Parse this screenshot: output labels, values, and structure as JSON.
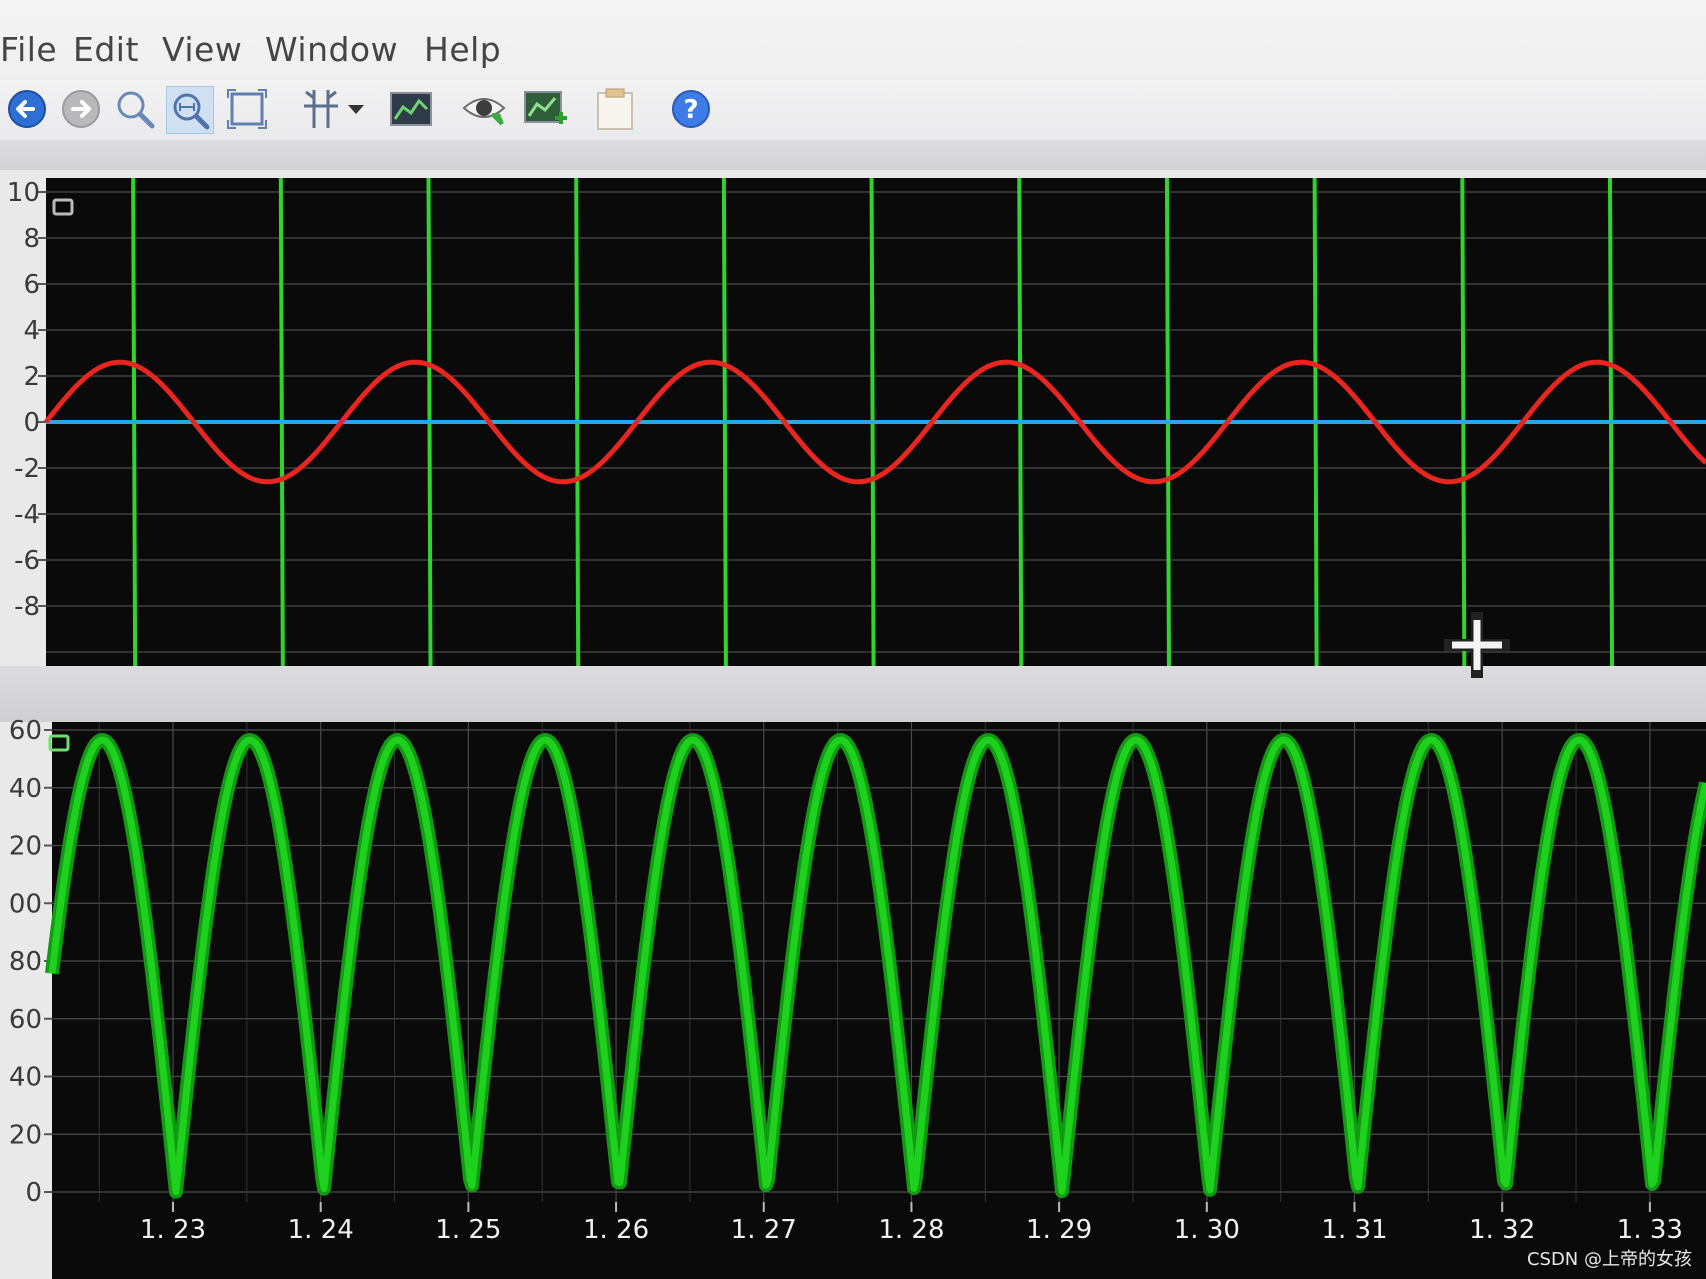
{
  "menu": {
    "items": [
      "File",
      "Edit",
      "View",
      "Window",
      "Help"
    ]
  },
  "toolbar": {
    "buttons": [
      {
        "name": "back-icon"
      },
      {
        "name": "forward-icon"
      },
      {
        "name": "zoom-icon"
      },
      {
        "name": "zoom-fit-icon"
      },
      {
        "name": "zoom-box-icon"
      },
      {
        "name": "cursor-tool-icon"
      },
      {
        "name": "dropdown-arrow-icon"
      },
      {
        "name": "plot-image-icon"
      },
      {
        "name": "eye-icon"
      },
      {
        "name": "add-plot-icon"
      },
      {
        "name": "notepad-icon"
      },
      {
        "name": "help-icon"
      }
    ]
  },
  "colors": {
    "plot_bg": "#0a0a0a",
    "grid": "#4a4a4a",
    "square_wave": "#2fd42f",
    "sine": "#e8261f",
    "zero_line": "#2aa6e6",
    "rectified": "#1fd11f"
  },
  "chart_data": [
    {
      "type": "line",
      "panel": "top",
      "yticks": [
        "10",
        "8",
        "6",
        "4",
        "2",
        "0",
        "-2",
        "-4",
        "-6",
        "-8"
      ],
      "ylim": [
        -10,
        10
      ],
      "xlim": [
        1.2214,
        1.3338
      ],
      "period": 0.02,
      "series": [
        {
          "color": "#e8261f",
          "style": "sine",
          "amplitude": 2.6,
          "crossings_up": [
            1.2414,
            1.2614,
            1.2814,
            1.3014,
            1.3214
          ]
        },
        {
          "color": "#2aa6e6",
          "style": "constant",
          "value": 0
        },
        {
          "color": "#2fd42f",
          "style": "vertical-edges",
          "edges": [
            1.2273,
            1.2373,
            1.2473,
            1.2573,
            1.2673,
            1.2773,
            1.2873,
            1.2973,
            1.3073,
            1.3173,
            1.3273
          ]
        }
      ]
    },
    {
      "type": "line",
      "panel": "bottom",
      "yticks": [
        "60",
        "40",
        "20",
        "00",
        "80",
        "60",
        "40",
        "20",
        "0"
      ],
      "xticks": [
        "1. 23",
        "1. 24",
        "1. 25",
        "1. 26",
        "1. 27",
        "1. 28",
        "1. 29",
        "1. 30",
        "1. 31",
        "1. 32",
        "1. 33"
      ],
      "xlim": [
        1.2214,
        1.3338
      ],
      "series": [
        {
          "color": "#1fd11f",
          "style": "rectified",
          "zeros": [
            1.2302,
            1.2402,
            1.2502,
            1.2602,
            1.2702,
            1.2802,
            1.2902,
            1.3002,
            1.3102,
            1.3202,
            1.3302
          ]
        }
      ]
    }
  ],
  "watermark": "CSDN @上帝的女孩"
}
